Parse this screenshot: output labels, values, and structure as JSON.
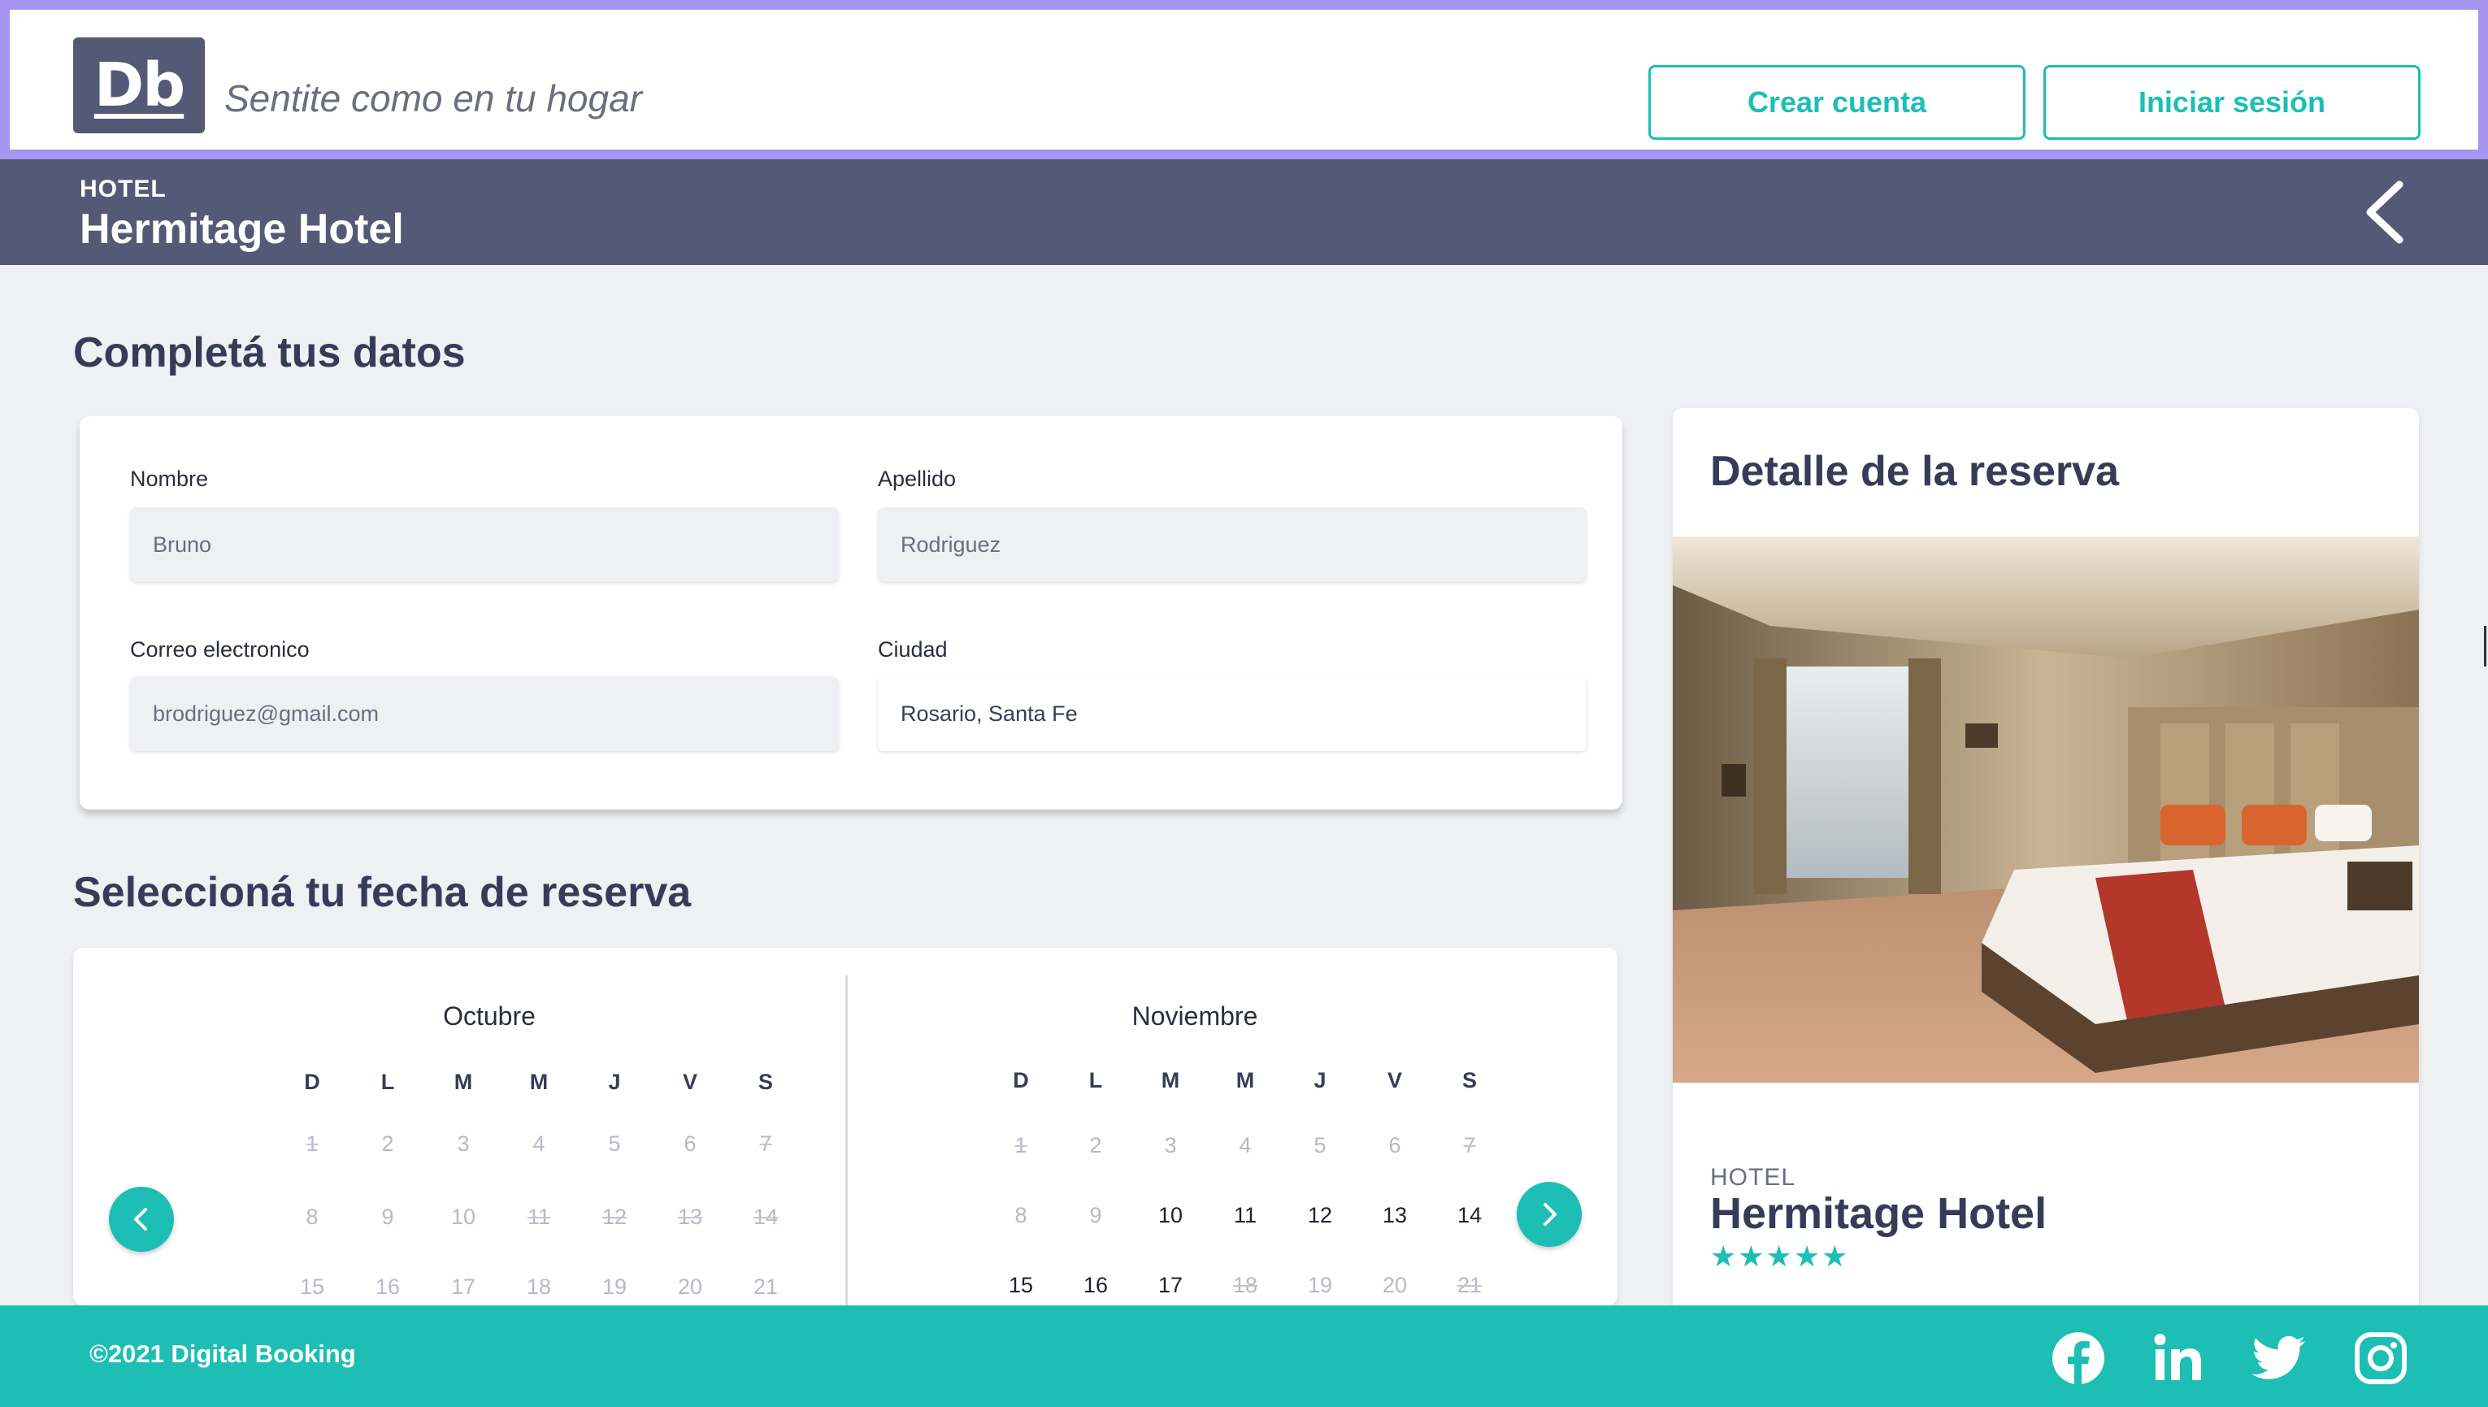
{
  "header": {
    "logo_text": "Db",
    "slogan": "Sentite como en tu hogar",
    "create_account": "Crear cuenta",
    "login": "Iniciar sesión"
  },
  "titlebar": {
    "category": "HOTEL",
    "name": "Hermitage Hotel"
  },
  "form": {
    "title": "Completá tus datos",
    "first_name": {
      "label": "Nombre",
      "value": "Bruno"
    },
    "last_name": {
      "label": "Apellido",
      "value": "Rodriguez"
    },
    "email": {
      "label": "Correo electronico",
      "value": "brodriguez@gmail.com"
    },
    "city": {
      "label": "Ciudad",
      "value": "Rosario, Santa Fe"
    }
  },
  "calendar": {
    "title": "Seleccioná tu fecha de reserva",
    "weekdays": [
      "D",
      "L",
      "M",
      "M",
      "J",
      "V",
      "S"
    ],
    "months": [
      {
        "name": "Octubre",
        "weeks": [
          [
            {
              "d": "1",
              "s": "past"
            },
            {
              "d": "2",
              "s": "muted"
            },
            {
              "d": "3",
              "s": "muted"
            },
            {
              "d": "4",
              "s": "muted"
            },
            {
              "d": "5",
              "s": "muted"
            },
            {
              "d": "6",
              "s": "muted"
            },
            {
              "d": "7",
              "s": "past"
            }
          ],
          [
            {
              "d": "8",
              "s": "muted"
            },
            {
              "d": "9",
              "s": "muted"
            },
            {
              "d": "10",
              "s": "muted"
            },
            {
              "d": "11",
              "s": "past"
            },
            {
              "d": "12",
              "s": "past"
            },
            {
              "d": "13",
              "s": "past"
            },
            {
              "d": "14",
              "s": "past"
            }
          ],
          [
            {
              "d": "15",
              "s": "muted"
            },
            {
              "d": "16",
              "s": "muted"
            },
            {
              "d": "17",
              "s": "muted"
            },
            {
              "d": "18",
              "s": "muted"
            },
            {
              "d": "19",
              "s": "muted"
            },
            {
              "d": "20",
              "s": "muted"
            },
            {
              "d": "21",
              "s": "muted"
            }
          ]
        ]
      },
      {
        "name": "Noviembre",
        "weeks": [
          [
            {
              "d": "1",
              "s": "past"
            },
            {
              "d": "2",
              "s": "muted"
            },
            {
              "d": "3",
              "s": "muted"
            },
            {
              "d": "4",
              "s": "muted"
            },
            {
              "d": "5",
              "s": "muted"
            },
            {
              "d": "6",
              "s": "muted"
            },
            {
              "d": "7",
              "s": "past"
            }
          ],
          [
            {
              "d": "8",
              "s": "muted"
            },
            {
              "d": "9",
              "s": "muted"
            },
            {
              "d": "10",
              "s": "avail"
            },
            {
              "d": "11",
              "s": "avail"
            },
            {
              "d": "12",
              "s": "avail"
            },
            {
              "d": "13",
              "s": "avail"
            },
            {
              "d": "14",
              "s": "avail"
            }
          ],
          [
            {
              "d": "15",
              "s": "avail"
            },
            {
              "d": "16",
              "s": "avail"
            },
            {
              "d": "17",
              "s": "avail"
            },
            {
              "d": "18",
              "s": "past"
            },
            {
              "d": "19",
              "s": "muted"
            },
            {
              "d": "20",
              "s": "muted"
            },
            {
              "d": "21",
              "s": "past"
            }
          ]
        ]
      }
    ]
  },
  "detail": {
    "title": "Detalle de la reserva",
    "category": "HOTEL",
    "name": "Hermitage Hotel",
    "stars": "★★★★★"
  },
  "footer": {
    "copyright": "©2021 Digital Booking",
    "social": [
      "facebook-icon",
      "linkedin-icon",
      "twitter-icon",
      "instagram-icon"
    ]
  },
  "colors": {
    "accent": "#1dbeb4",
    "primary": "#545975",
    "header_border": "#a594f0",
    "background": "#eef0f3"
  }
}
